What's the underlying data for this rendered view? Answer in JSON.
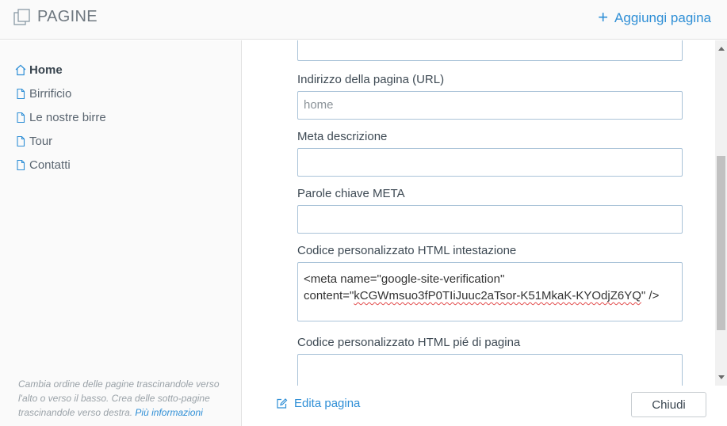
{
  "header": {
    "title": "PAGINE",
    "add_page_label": "Aggiungi pagina",
    "add_icon": "plus-icon"
  },
  "sidebar": {
    "items": [
      {
        "label": "Home",
        "icon": "home-icon",
        "active": true
      },
      {
        "label": "Birrificio",
        "icon": "page-icon"
      },
      {
        "label": "Le nostre birre",
        "icon": "page-icon"
      },
      {
        "label": "Tour",
        "icon": "page-icon"
      },
      {
        "label": "Contatti",
        "icon": "page-icon"
      }
    ],
    "hint_text": "Cambia ordine delle pagine trascinandole verso l'alto o verso il basso. Crea delle sotto-pagine trascinandole verso destra.",
    "hint_link": "Più informazioni"
  },
  "form": {
    "url_label": "Indirizzo della pagina (URL)",
    "url_value": "home",
    "meta_desc_label": "Meta descrizione",
    "meta_desc_value": "",
    "meta_keywords_label": "Parole chiave META",
    "meta_keywords_value": "",
    "header_code_label": "Codice personalizzato HTML intestazione",
    "header_code_line1": "<meta name=\"google-site-verification\"",
    "header_code_prefix": "content=\"",
    "header_code_token": "kCGWmsuo3fP0TIiJuuc2aTsor-K51MkaK-KYOdjZ6YQ",
    "header_code_suffix": "\" />",
    "footer_code_label": "Codice personalizzato HTML pié di pagina",
    "footer_code_value": ""
  },
  "footer": {
    "edit_label": "Edita pagina",
    "close_label": "Chiudi"
  },
  "colors": {
    "accent": "#2f8fd6",
    "input_border": "#aac3d8",
    "sidebar_bg": "#fafafa"
  }
}
